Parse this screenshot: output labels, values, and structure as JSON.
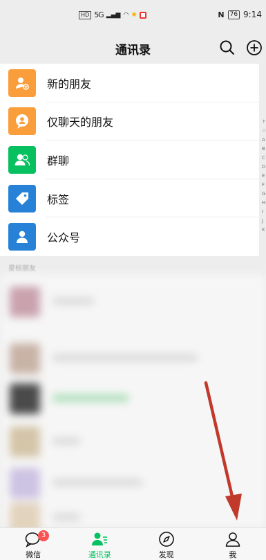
{
  "status_bar": {
    "hd": "HD",
    "signal": "5G",
    "battery": "76",
    "time": "9:14"
  },
  "header": {
    "title": "通讯录",
    "search_icon": "search-icon",
    "add_icon": "plus-circle-icon"
  },
  "menu": {
    "items": [
      {
        "label": "新的朋友",
        "icon": "add-friend-icon",
        "color": "#fa9d3b"
      },
      {
        "label": "仅聊天的朋友",
        "icon": "chat-bubble-icon",
        "color": "#fa9d3b"
      },
      {
        "label": "群聊",
        "icon": "group-icon",
        "color": "#07c160"
      },
      {
        "label": "标签",
        "icon": "tag-icon",
        "color": "#2782d7"
      },
      {
        "label": "公众号",
        "icon": "person-icon",
        "color": "#2782d7"
      }
    ]
  },
  "index": [
    "↑",
    "☆",
    "A",
    "B",
    "C",
    "D",
    "E",
    "F",
    "G",
    "H",
    "I",
    "J",
    "K"
  ],
  "starred_section": {
    "label": "星标朋友"
  },
  "tab_bar": {
    "tabs": [
      {
        "label": "微信",
        "icon": "chat-icon",
        "badge": "3",
        "active": false
      },
      {
        "label": "通讯录",
        "icon": "contacts-icon",
        "active": true
      },
      {
        "label": "发现",
        "icon": "compass-icon",
        "active": false
      },
      {
        "label": "我",
        "icon": "person-icon",
        "active": false
      }
    ]
  },
  "colors": {
    "accent": "#07c160",
    "badge": "#fa5151",
    "arrow": "#c0392b"
  }
}
